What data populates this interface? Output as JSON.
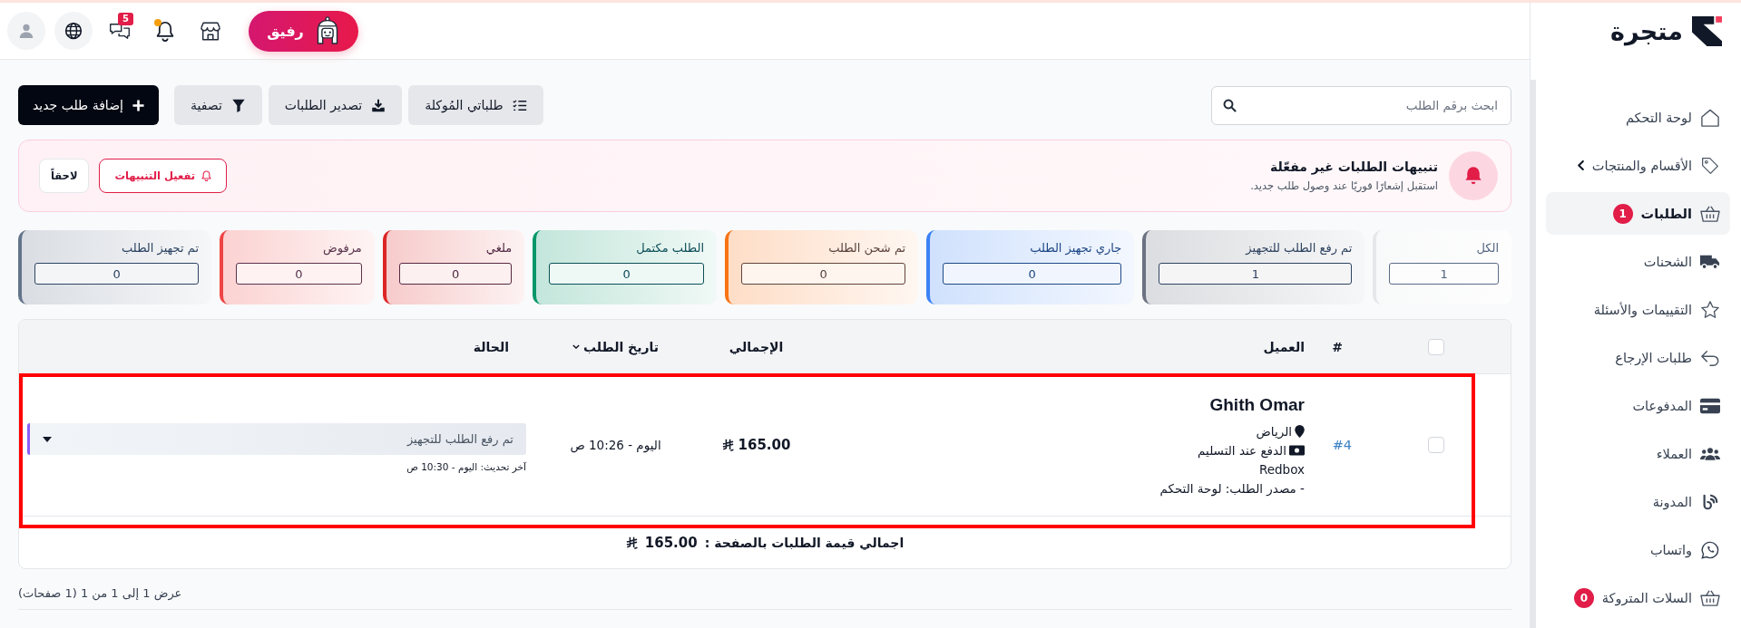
{
  "topbar": {
    "assistant_label": "رفيق",
    "message_count": "5",
    "notifications_unread": true
  },
  "sidebar": {
    "logo": "متجرة",
    "items": [
      {
        "label": "لوحة التحكم",
        "kind": "link",
        "selected": false
      },
      {
        "label": "الأقسام والمنتجات",
        "kind": "submenu",
        "selected": false
      },
      {
        "label": "الطلبات",
        "kind": "link",
        "selected": true,
        "badge": "1"
      },
      {
        "label": "الشحنات",
        "kind": "link",
        "selected": false
      },
      {
        "label": "التقييمات والأسئلة",
        "kind": "link",
        "selected": false
      },
      {
        "label": "طلبات الإرجاع",
        "kind": "link",
        "selected": false
      },
      {
        "label": "المدفوعات",
        "kind": "link",
        "selected": false
      },
      {
        "label": "العملاء",
        "kind": "link",
        "selected": false
      },
      {
        "label": "المدونة",
        "kind": "link",
        "selected": false
      },
      {
        "label": "واتساب",
        "kind": "link",
        "selected": false
      },
      {
        "label": "السلات المتروكة",
        "kind": "link",
        "selected": false,
        "badge": "0"
      }
    ]
  },
  "toolbar": {
    "search": {
      "placeholder": "ابحث برقم الطلب"
    },
    "buttons": [
      {
        "label": "طلباتي المُوكلة",
        "kind": "secondary"
      },
      {
        "label": "تصدير الطلبات",
        "kind": "secondary"
      },
      {
        "label": "تصفية",
        "kind": "secondary"
      },
      {
        "label": "إضافة طلب جديد",
        "kind": "primary"
      }
    ]
  },
  "alert": {
    "title": "تنبيهات الطلبات غير مفعّلة",
    "message": "استقبل إشعارًا فوريًا عند وصول طلب جديد.",
    "buttons": [
      {
        "label": "تفعيل التنبيهات",
        "kind": "primary"
      },
      {
        "label": "لاحقاً",
        "kind": "secondary"
      }
    ]
  },
  "status_cards": [
    {
      "label": "الكل",
      "count": "1",
      "color": "#e5e7eb"
    },
    {
      "label": "تم رفع الطلب للتجهيز",
      "count": "1",
      "color": "#6b7280"
    },
    {
      "label": "جاري تجهيز الطلب",
      "count": "0",
      "color": "#3b82f6"
    },
    {
      "label": "تم شحن الطلب",
      "count": "0",
      "color": "#f97316"
    },
    {
      "label": "الطلب مكتمل",
      "count": "0",
      "color": "#059669"
    },
    {
      "label": "ملغي",
      "count": "0",
      "color": "#dc2626"
    },
    {
      "label": "مرفوض",
      "count": "0",
      "color": "#ef4444"
    },
    {
      "label": "تم تجهيز الطلب",
      "count": "0",
      "color": "#64748b"
    }
  ],
  "table": {
    "select_all_checked": false,
    "columns": [
      {
        "label": "#",
        "sortable": false
      },
      {
        "label": "العميل",
        "sortable": false
      },
      {
        "label": "الإجمالي",
        "sortable": false
      },
      {
        "label": "تاريخ الطلب",
        "sortable": true
      },
      {
        "label": "الحالة",
        "sortable": false
      }
    ],
    "rows": [
      {
        "checked": false,
        "highlighted": true,
        "number": "#4",
        "customer": "Ghith Omar",
        "city": "الرياض",
        "payment": "الدفع عند التسليم",
        "shipping": "Redbox",
        "source": "- مصدر الطلب: لوحة التحكم",
        "total": "165.00",
        "date": "اليوم - 10:26 ص",
        "status": {
          "label": "تم رفع الطلب للتجهيز",
          "color": "#8b5cf6",
          "updated": "آخر تحديث: اليوم - 10:30 ص"
        }
      }
    ],
    "page_total_label": "اجمالي قيمة الطلبات بالصفحة :",
    "page_total": "165.00"
  },
  "pagination": "عرض 1 إلى 1 من 1 (1 صفحات)"
}
